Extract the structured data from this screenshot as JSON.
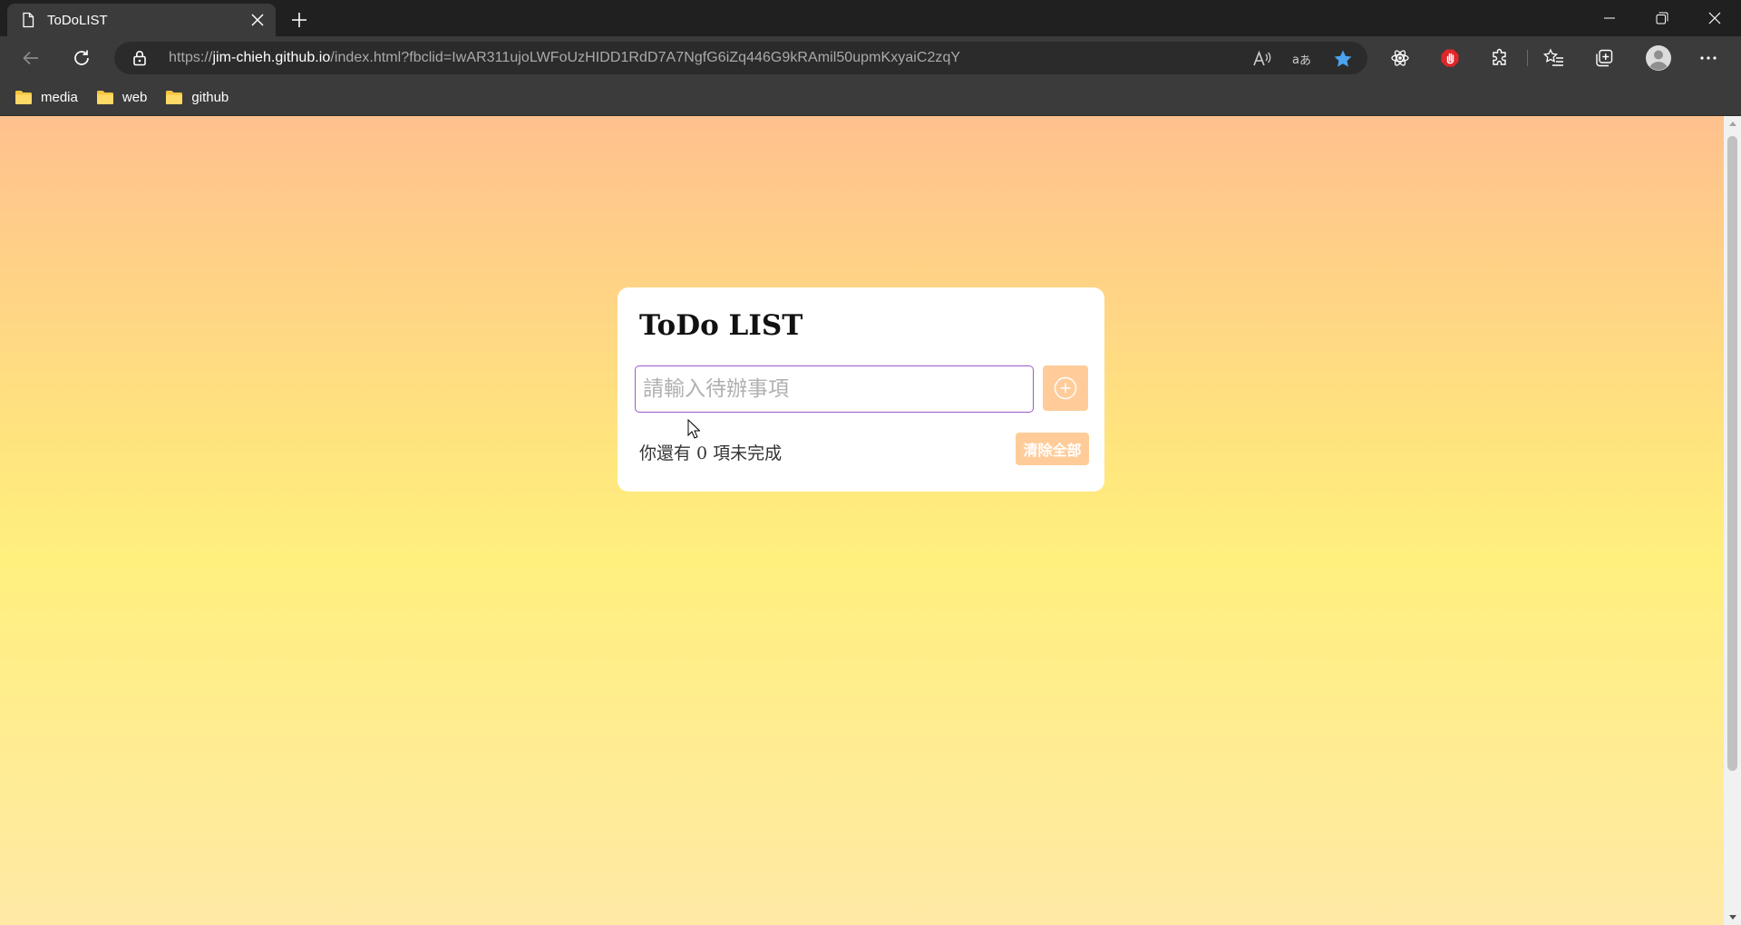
{
  "browser": {
    "tab": {
      "title": "ToDoLIST",
      "icon": "page-icon",
      "close_icon": "close-icon"
    },
    "new_tab_icon": "plus-icon",
    "window_controls": [
      "minimize-icon",
      "restore-icon",
      "close-icon"
    ],
    "address": {
      "scheme": "https://",
      "host": "jim-chieh.github.io",
      "path": "/index.html?fbclid=IwAR311ujoLWFoUzHIDD1RdD7A7NgfG6iZq446G9kRAmil50upmKxyaiC2zqY"
    },
    "toolbar_icons": [
      "back-icon",
      "refresh-icon",
      "lock-icon",
      "read-aloud-icon",
      "translate-icon",
      "favorite-star-icon",
      "react-devtools-icon",
      "adblock-icon",
      "extensions-icon",
      "favorites-icon",
      "collections-icon",
      "profile-icon",
      "more-icon"
    ],
    "bookmarks": [
      {
        "label": "media"
      },
      {
        "label": "web"
      },
      {
        "label": "github"
      }
    ]
  },
  "app": {
    "title": "ToDo LIST",
    "input": {
      "placeholder": "請輸入待辦事項",
      "value": ""
    },
    "add_button_icon": "add-circle-icon",
    "status": {
      "prefix": "你還有",
      "count": "0",
      "suffix": "項未完成"
    },
    "clear_button": "清除全部"
  },
  "colors": {
    "accent": "#ffcc99",
    "input_border": "#9b59c9",
    "gradient_top": "#ffc18e",
    "gradient_mid": "#fff07e"
  }
}
